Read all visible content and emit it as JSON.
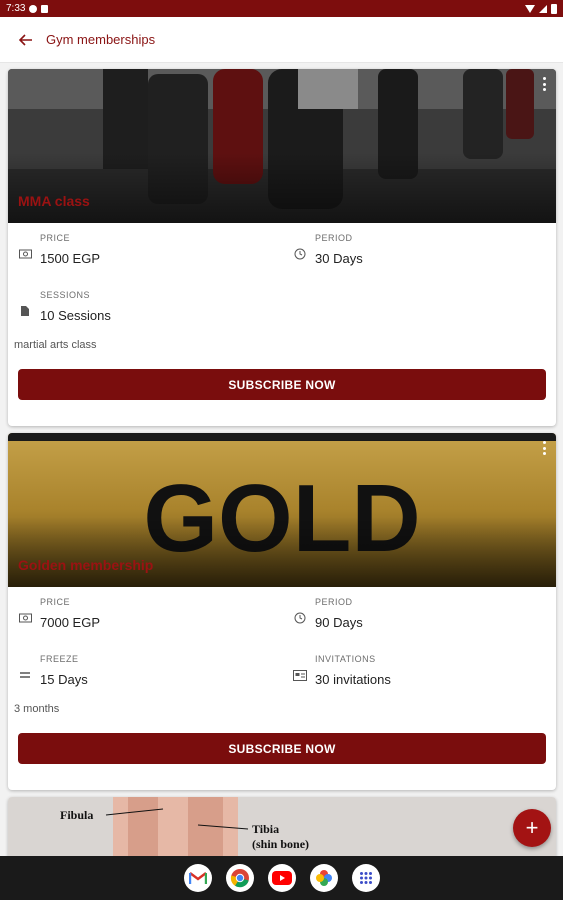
{
  "status_bar": {
    "time": "7:33"
  },
  "app_bar": {
    "title": "Gym memberships"
  },
  "cards": [
    {
      "title": "MMA class",
      "fields": [
        {
          "label": "PRICE",
          "value": "1500 EGP",
          "icon": "money-icon"
        },
        {
          "label": "PERIOD",
          "value": "30 Days",
          "icon": "clock-icon"
        },
        {
          "label": "SESSIONS",
          "value": "10 Sessions",
          "icon": "document-icon"
        }
      ],
      "description": "martial arts class",
      "button": "SUBSCRIBE NOW"
    },
    {
      "title": "Golden membership",
      "image_text": "GOLD",
      "fields": [
        {
          "label": "PRICE",
          "value": "7000 EGP",
          "icon": "money-icon"
        },
        {
          "label": "PERIOD",
          "value": "90 Days",
          "icon": "clock-icon"
        },
        {
          "label": "FREEZE",
          "value": "15 Days",
          "icon": "freeze-icon"
        },
        {
          "label": "INVITATIONS",
          "value": "30 invitations",
          "icon": "ticket-icon"
        }
      ],
      "description": "3 months",
      "button": "SUBSCRIBE NOW"
    },
    {
      "image_labels": [
        "Fibula",
        "Tibia",
        "(shin bone)"
      ]
    }
  ],
  "fab": {
    "label": "+"
  },
  "nav_apps": [
    "gmail-icon",
    "chrome-icon",
    "youtube-icon",
    "photos-icon",
    "app-drawer-icon"
  ],
  "colors": {
    "primary": "#7a0d0d",
    "accent": "#a31313",
    "status_bar": "#7d0d0d"
  }
}
